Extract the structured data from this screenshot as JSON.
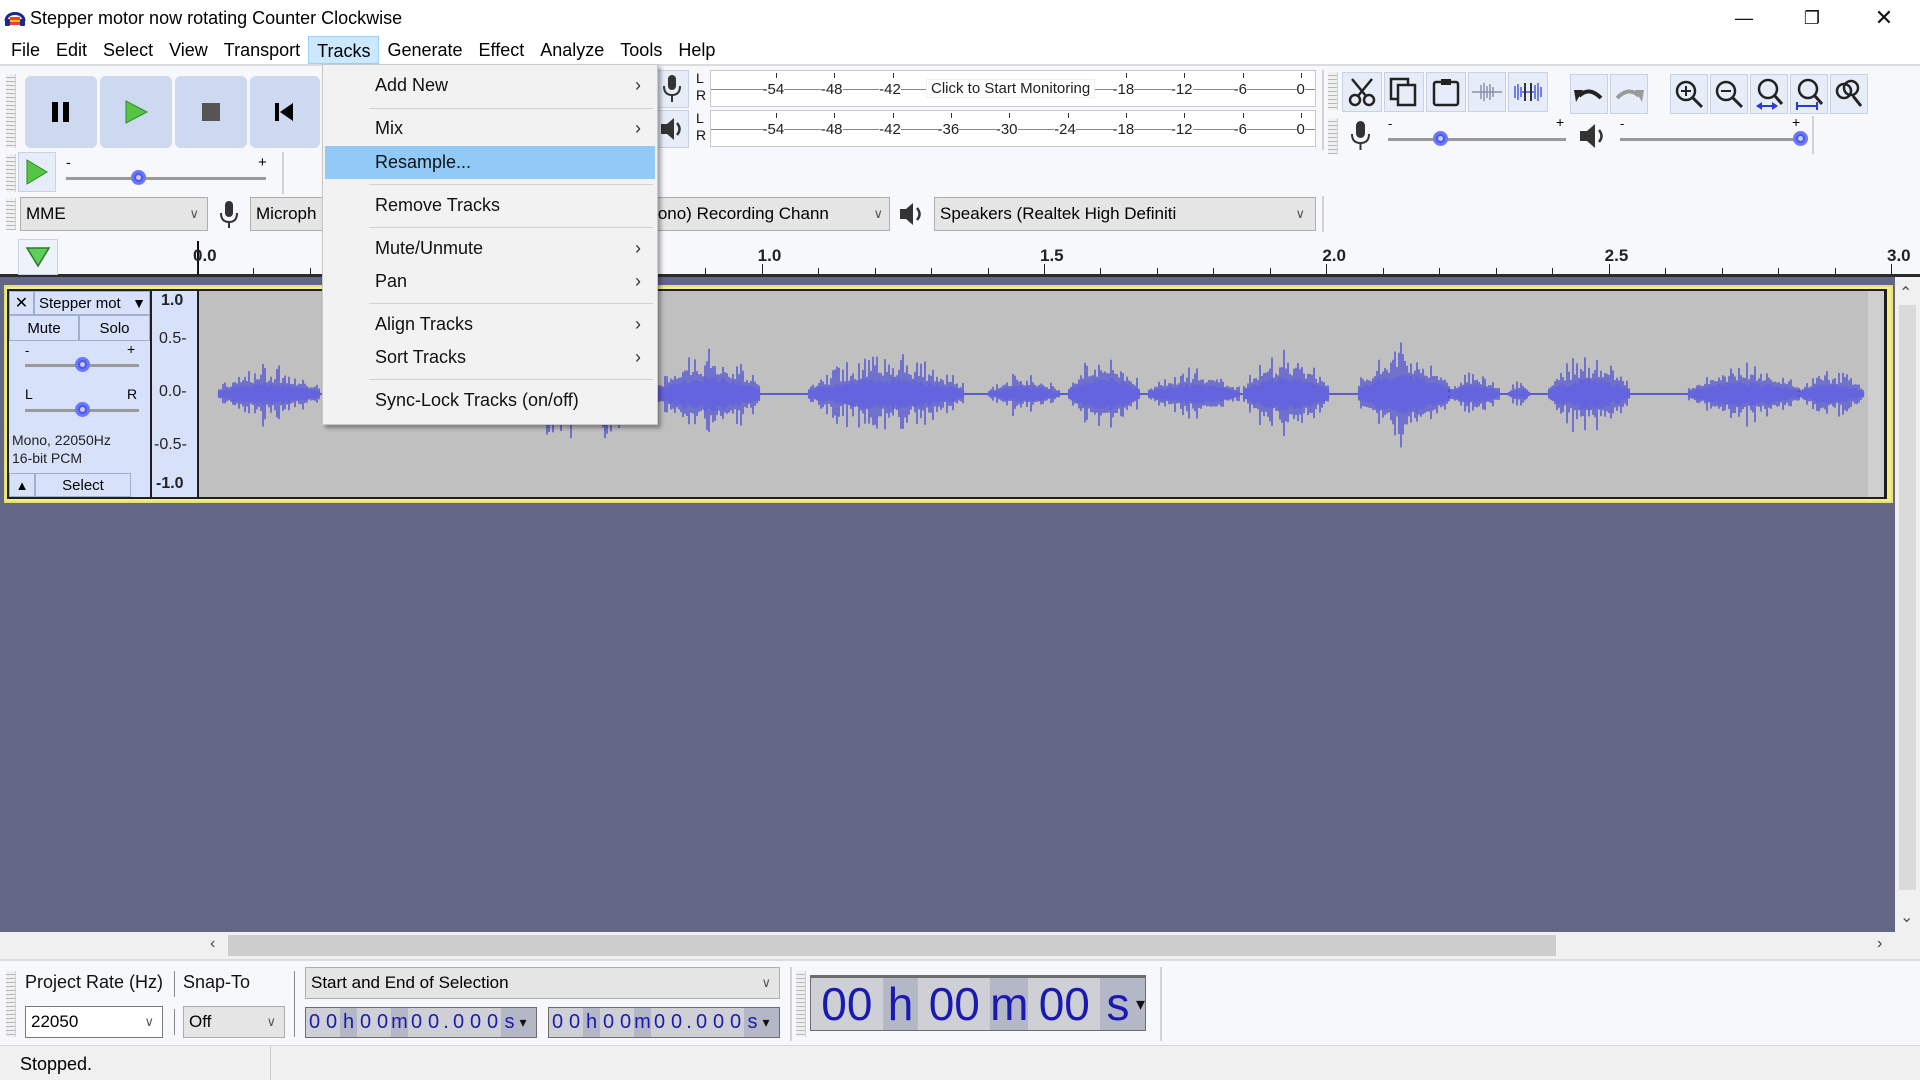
{
  "window": {
    "title": "Stepper motor now rotating Counter Clockwise",
    "minimize": "—",
    "restore": "❐",
    "close": "✕"
  },
  "menubar": {
    "items": [
      "File",
      "Edit",
      "Select",
      "View",
      "Transport",
      "Tracks",
      "Generate",
      "Effect",
      "Analyze",
      "Tools",
      "Help"
    ],
    "open_item": "Tracks"
  },
  "tracks_menu": {
    "items": [
      {
        "label": "Add New",
        "submenu": true
      },
      {
        "label": "Mix",
        "submenu": true
      },
      {
        "label": "Resample...",
        "submenu": false,
        "highlighted": true
      },
      {
        "label": "Remove Tracks",
        "submenu": false
      },
      {
        "label": "Mute/Unmute",
        "submenu": true
      },
      {
        "label": "Pan",
        "submenu": true
      },
      {
        "label": "Align Tracks",
        "submenu": true
      },
      {
        "label": "Sort Tracks",
        "submenu": true
      },
      {
        "label": "Sync-Lock Tracks (on/off)",
        "submenu": false
      }
    ],
    "submenu_arrow": "›"
  },
  "transport": {
    "buttons": [
      {
        "name": "pause",
        "icon": "pause-icon"
      },
      {
        "name": "play",
        "icon": "play-icon"
      },
      {
        "name": "stop",
        "icon": "stop-icon"
      },
      {
        "name": "skip-to-start",
        "icon": "skip-start-icon"
      }
    ]
  },
  "play_at_speed": {
    "minus": "-",
    "plus": "+",
    "value_fraction": 0.36
  },
  "meters": {
    "record": {
      "L": "L",
      "R": "R",
      "ticks": [
        "-54",
        "-48",
        "-42",
        "-18",
        "-12",
        "-6",
        "0"
      ],
      "monitor_label": "Click to Start Monitoring"
    },
    "playback": {
      "L": "L",
      "R": "R",
      "ticks": [
        "-54",
        "-48",
        "-42",
        "-36",
        "-30",
        "-24",
        "-18",
        "-12",
        "-6",
        "0"
      ]
    }
  },
  "edit_tools": {
    "buttons": [
      "cut-icon",
      "copy-icon",
      "paste-icon",
      "trim-icon",
      "silence-icon",
      "undo-icon",
      "redo-icon",
      "zoom-in-icon",
      "zoom-out-icon",
      "fit-selection-icon",
      "fit-project-icon",
      "zoom-toggle-icon"
    ]
  },
  "mixer": {
    "record_volume": {
      "minus": "-",
      "plus": "+",
      "value_fraction": 0.29
    },
    "playback_volume": {
      "minus": "-",
      "plus": "+",
      "value_fraction": 1.0
    }
  },
  "device": {
    "host": "MME",
    "input": "Microph",
    "channels": "(Mono) Recording Chann",
    "output": "Speakers (Realtek High Definiti"
  },
  "ruler": {
    "labels": [
      "0.0",
      "1.0",
      "1.5",
      "2.0",
      "2.5",
      "3.0"
    ],
    "values": [
      0.0,
      1.0,
      1.5,
      2.0,
      2.5,
      3.0
    ]
  },
  "track": {
    "name": "Stepper mot",
    "close": "✕",
    "menu_arrow": "▼",
    "mute": "Mute",
    "solo": "Solo",
    "gain_minus": "-",
    "gain_plus": "+",
    "gain_fraction": 0.5,
    "pan_left": "L",
    "pan_right": "R",
    "pan_fraction": 0.5,
    "info_line1": "Mono, 22050Hz",
    "info_line2": "16-bit PCM",
    "collapse": "▲",
    "select": "Select",
    "scale": [
      "1.0",
      "0.5-",
      "0.0-",
      "-0.5-",
      "-1.0"
    ]
  },
  "selection_toolbar": {
    "project_rate_label": "Project Rate (Hz)",
    "project_rate": "22050",
    "snap_label": "Snap-To",
    "snap_value": "Off",
    "selection_mode": "Start and End of Selection",
    "start_time": [
      "0",
      "0",
      "h",
      "0",
      "0",
      "m",
      "0",
      "0",
      ".",
      "0",
      "0",
      "0",
      "s"
    ],
    "end_time": [
      "0",
      "0",
      "h",
      "0",
      "0",
      "m",
      "0",
      "0",
      ".",
      "0",
      "0",
      "0",
      "s"
    ],
    "audio_position": [
      "00",
      "h",
      "00",
      "m",
      "00",
      "s"
    ]
  },
  "status": {
    "text": "Stopped."
  },
  "colors": {
    "waveform": "#3b3bd6",
    "track_bg": "#c0c0c0",
    "selected_track_border": "#f4ee86",
    "empty_area": "#636685",
    "menu_highlight": "#91c9f7"
  }
}
